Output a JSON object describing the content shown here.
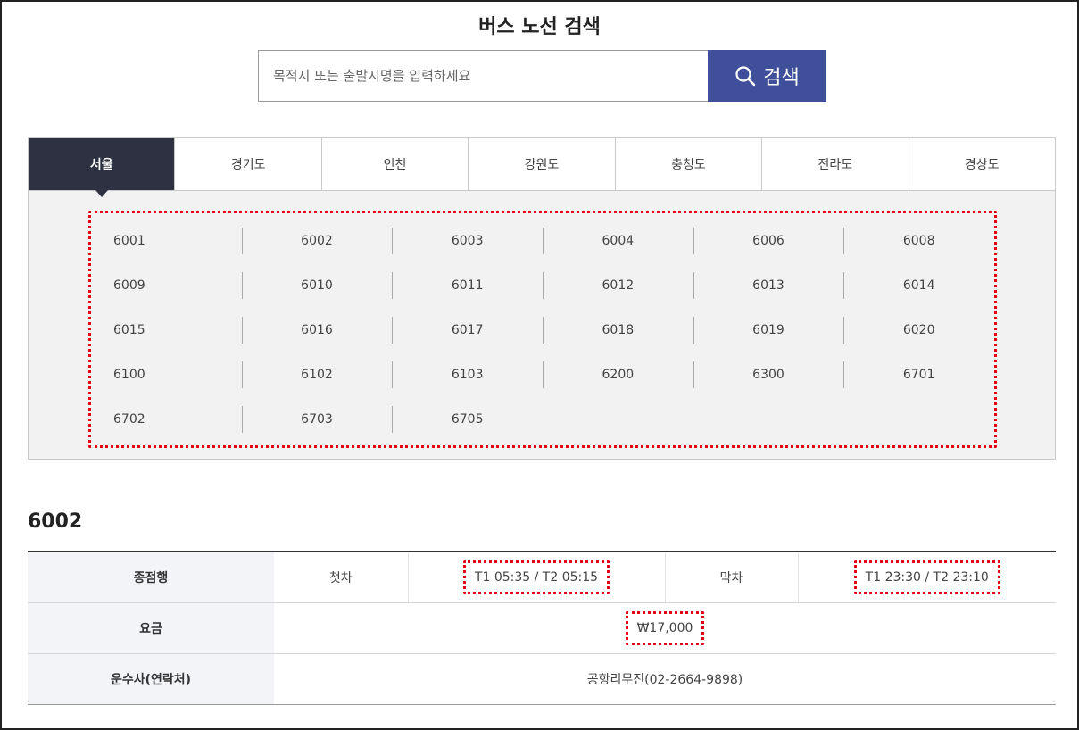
{
  "page": {
    "title": "버스 노선 검색"
  },
  "search": {
    "placeholder": "목적지 또는 출발지명을 입력하세요",
    "button_label": "검색"
  },
  "tabs": [
    {
      "label": "서울",
      "active": true
    },
    {
      "label": "경기도",
      "active": false
    },
    {
      "label": "인천",
      "active": false
    },
    {
      "label": "강원도",
      "active": false
    },
    {
      "label": "충청도",
      "active": false
    },
    {
      "label": "전라도",
      "active": false
    },
    {
      "label": "경상도",
      "active": false
    }
  ],
  "routes": [
    "6001",
    "6002",
    "6003",
    "6004",
    "6006",
    "6008",
    "6009",
    "6010",
    "6011",
    "6012",
    "6013",
    "6014",
    "6015",
    "6016",
    "6017",
    "6018",
    "6019",
    "6020",
    "6100",
    "6102",
    "6103",
    "6200",
    "6300",
    "6701",
    "6702",
    "6703",
    "6705"
  ],
  "detail": {
    "route_number": "6002",
    "rows": {
      "direction": {
        "label": "종점행",
        "first_label": "첫차",
        "first_value": "T1 05:35 / T2 05:15",
        "last_label": "막차",
        "last_value": "T1 23:30 / T2 23:10"
      },
      "fare": {
        "label": "요금",
        "value": "₩17,000"
      },
      "operator": {
        "label": "운수사(연락처)",
        "value": "공항리무진(02-2664-9898)"
      }
    }
  },
  "colors": {
    "accent": "#3f4f99",
    "active_tab": "#2e3142",
    "highlight": "#e60012"
  }
}
